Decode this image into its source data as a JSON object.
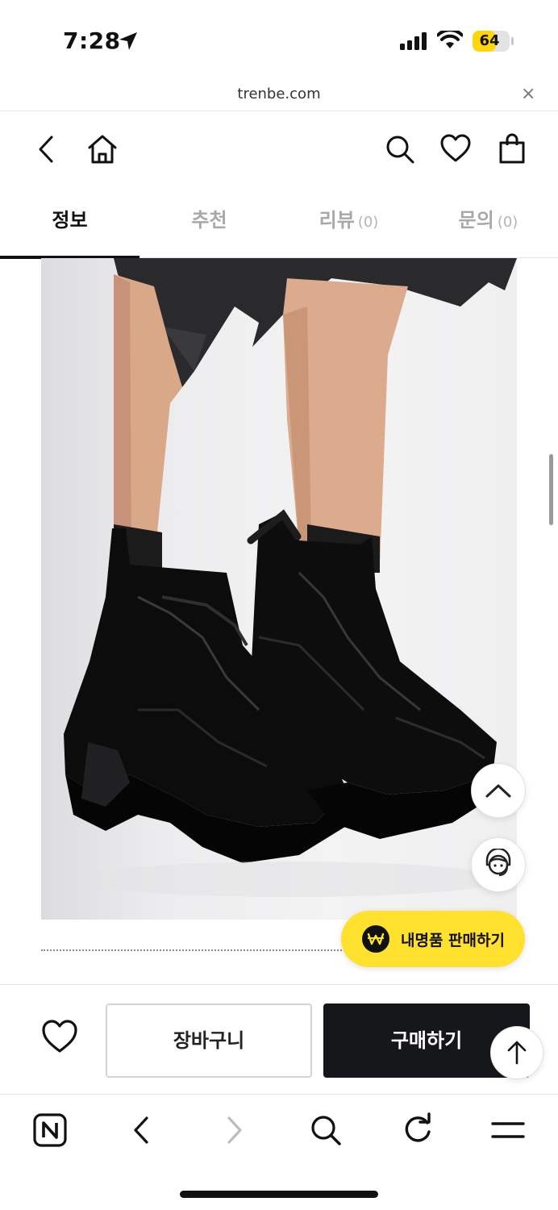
{
  "status_bar": {
    "time": "7:28",
    "battery": "64",
    "battery_level": 0.64
  },
  "browser": {
    "url": "trenbe.com",
    "close_symbol": "×"
  },
  "header": {
    "icons": [
      "back-icon",
      "home-icon",
      "search-icon",
      "heart-icon",
      "shopping-bag-icon"
    ]
  },
  "tabs": [
    {
      "label": "정보",
      "count": "",
      "active": true
    },
    {
      "label": "추천",
      "count": "",
      "active": false
    },
    {
      "label": "리뷰",
      "count": "(0)",
      "active": false
    },
    {
      "label": "문의",
      "count": "(0)",
      "active": false
    }
  ],
  "floating": {
    "sell_label": "내명품 판매하기",
    "sell_icon": "won-icon",
    "scroll_top_icon": "chevron-up-icon",
    "support_icon": "headset-agent-icon"
  },
  "purchase_bar": {
    "cart_label": "장바구니",
    "buy_label": "구매하기",
    "wish_icon": "heart-icon",
    "top_icon": "arrow-up-icon"
  },
  "toolbar": {
    "icons": [
      "naver-n-icon",
      "back-arrow-icon",
      "forward-arrow-icon",
      "search-icon",
      "refresh-icon",
      "menu-icon"
    ]
  },
  "colors": {
    "accent_yellow": "#ffe12e",
    "buy_button": "#15171a",
    "active_tab": "#111111",
    "inactive_tab": "#a8a8a8"
  }
}
